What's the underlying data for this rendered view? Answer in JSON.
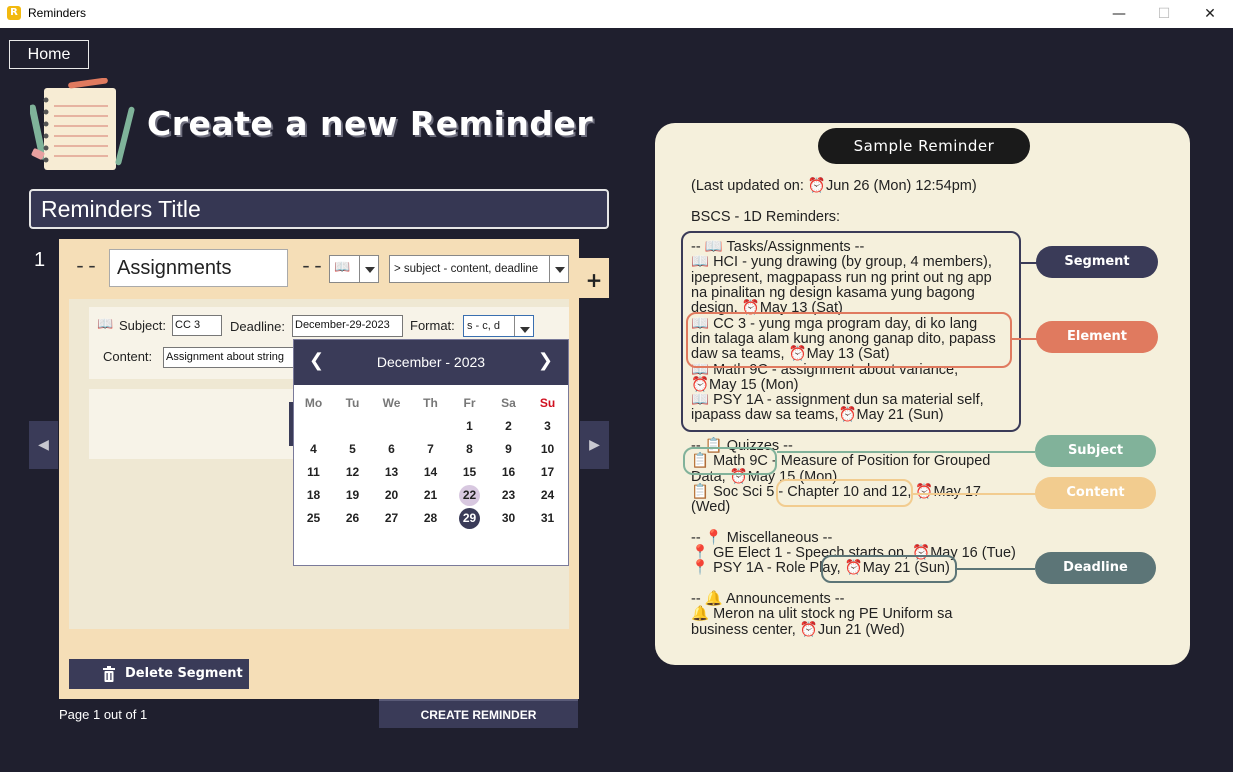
{
  "window": {
    "app_icon": "R",
    "title": "Reminders",
    "minimize": "—",
    "maximize": "☐",
    "close": "✕"
  },
  "home": {
    "label": "Home"
  },
  "page_title": "Create a new Reminder",
  "reminders_title": {
    "value": "Reminders Title"
  },
  "segment": {
    "number": "1",
    "dash_left": "--",
    "dash_right": "--",
    "name": "Assignments",
    "icon_value": "📖",
    "format_value": "> subject - content, deadline",
    "add_button": "+",
    "element": {
      "subject_label": "Subject:",
      "subject_value": "CC 3",
      "deadline_label": "Deadline:",
      "deadline_value": "December-29-2023",
      "format_label": "Format:",
      "format_value": "s - c, d",
      "content_label": "Content:",
      "content_value": "Assignment about string"
    },
    "delete_label": "Delete Segment"
  },
  "nav": {
    "prev": "◀",
    "next": "▶"
  },
  "page_info": "Page 1 out of 1",
  "create_button": "CREATE REMINDER",
  "calendar": {
    "month_label": "December - 2023",
    "prev": "❮",
    "next": "❯",
    "weekdays": [
      "Mo",
      "Tu",
      "We",
      "Th",
      "Fr",
      "Sa",
      "Su"
    ],
    "weeks": [
      [
        "",
        "",
        "",
        "",
        "1",
        "2",
        "3"
      ],
      [
        "4",
        "5",
        "6",
        "7",
        "8",
        "9",
        "10"
      ],
      [
        "11",
        "12",
        "13",
        "14",
        "15",
        "16",
        "17"
      ],
      [
        "18",
        "19",
        "20",
        "21",
        "22",
        "23",
        "24"
      ],
      [
        "25",
        "26",
        "27",
        "28",
        "29",
        "30",
        "31"
      ]
    ],
    "today": "22",
    "selected": "29"
  },
  "sample": {
    "title": "Sample Reminder",
    "lines": [
      "(Last updated on: ⏰Jun 26 (Mon) 12:54pm)",
      "",
      "BSCS - 1D Reminders:",
      "",
      "-- 📖 Tasks/Assignments --",
      "📖 HCI - yung drawing (by group, 4 members),",
      "ipepresent, magpapass run ng print out ng app",
      "na pinalitan ng design kasama yung bagong",
      "design, ⏰May 13 (Sat)",
      "📖 CC 3 - yung mga program day, di ko lang",
      "din talaga alam kung anong ganap dito, papass",
      "daw sa teams, ⏰May 13 (Sat)",
      "📖 Math 9C - assignment about variance,",
      "⏰May 15 (Mon)",
      "📖 PSY 1A - assignment dun sa material self,",
      "ipapass daw sa teams,⏰May 21 (Sun)",
      "",
      "-- 📋 Quizzes --",
      "📋 Math 9C - Measure of Position for Grouped",
      "Data, ⏰May 15 (Mon)",
      "📋 Soc Sci 5 - Chapter 10 and 12, ⏰May 17",
      "(Wed)",
      "",
      "-- 📍 Miscellaneous --",
      "📍 GE Elect 1 - Speech starts on, ⏰May 16 (Tue)",
      "📍 PSY 1A - Role Play, ⏰May 21 (Sun)",
      "",
      "-- 🔔 Announcements --",
      "🔔 Meron na ulit stock ng PE Uniform sa",
      "business center, ⏰Jun 21 (Wed)"
    ],
    "tags": {
      "segment": "Segment",
      "element": "Element",
      "subject": "Subject",
      "content": "Content",
      "deadline": "Deadline"
    }
  },
  "colors": {
    "background": "#1f1f2e",
    "accent": "#3a3b58",
    "segment_bg": "#f5deb7",
    "card_bg": "#f5f0dc",
    "segment_tag": "#3a3b58",
    "element_tag": "#e07a5f",
    "subject_tag": "#81b29a",
    "content_tag": "#f2cc8f",
    "deadline_tag": "#5c7577"
  }
}
